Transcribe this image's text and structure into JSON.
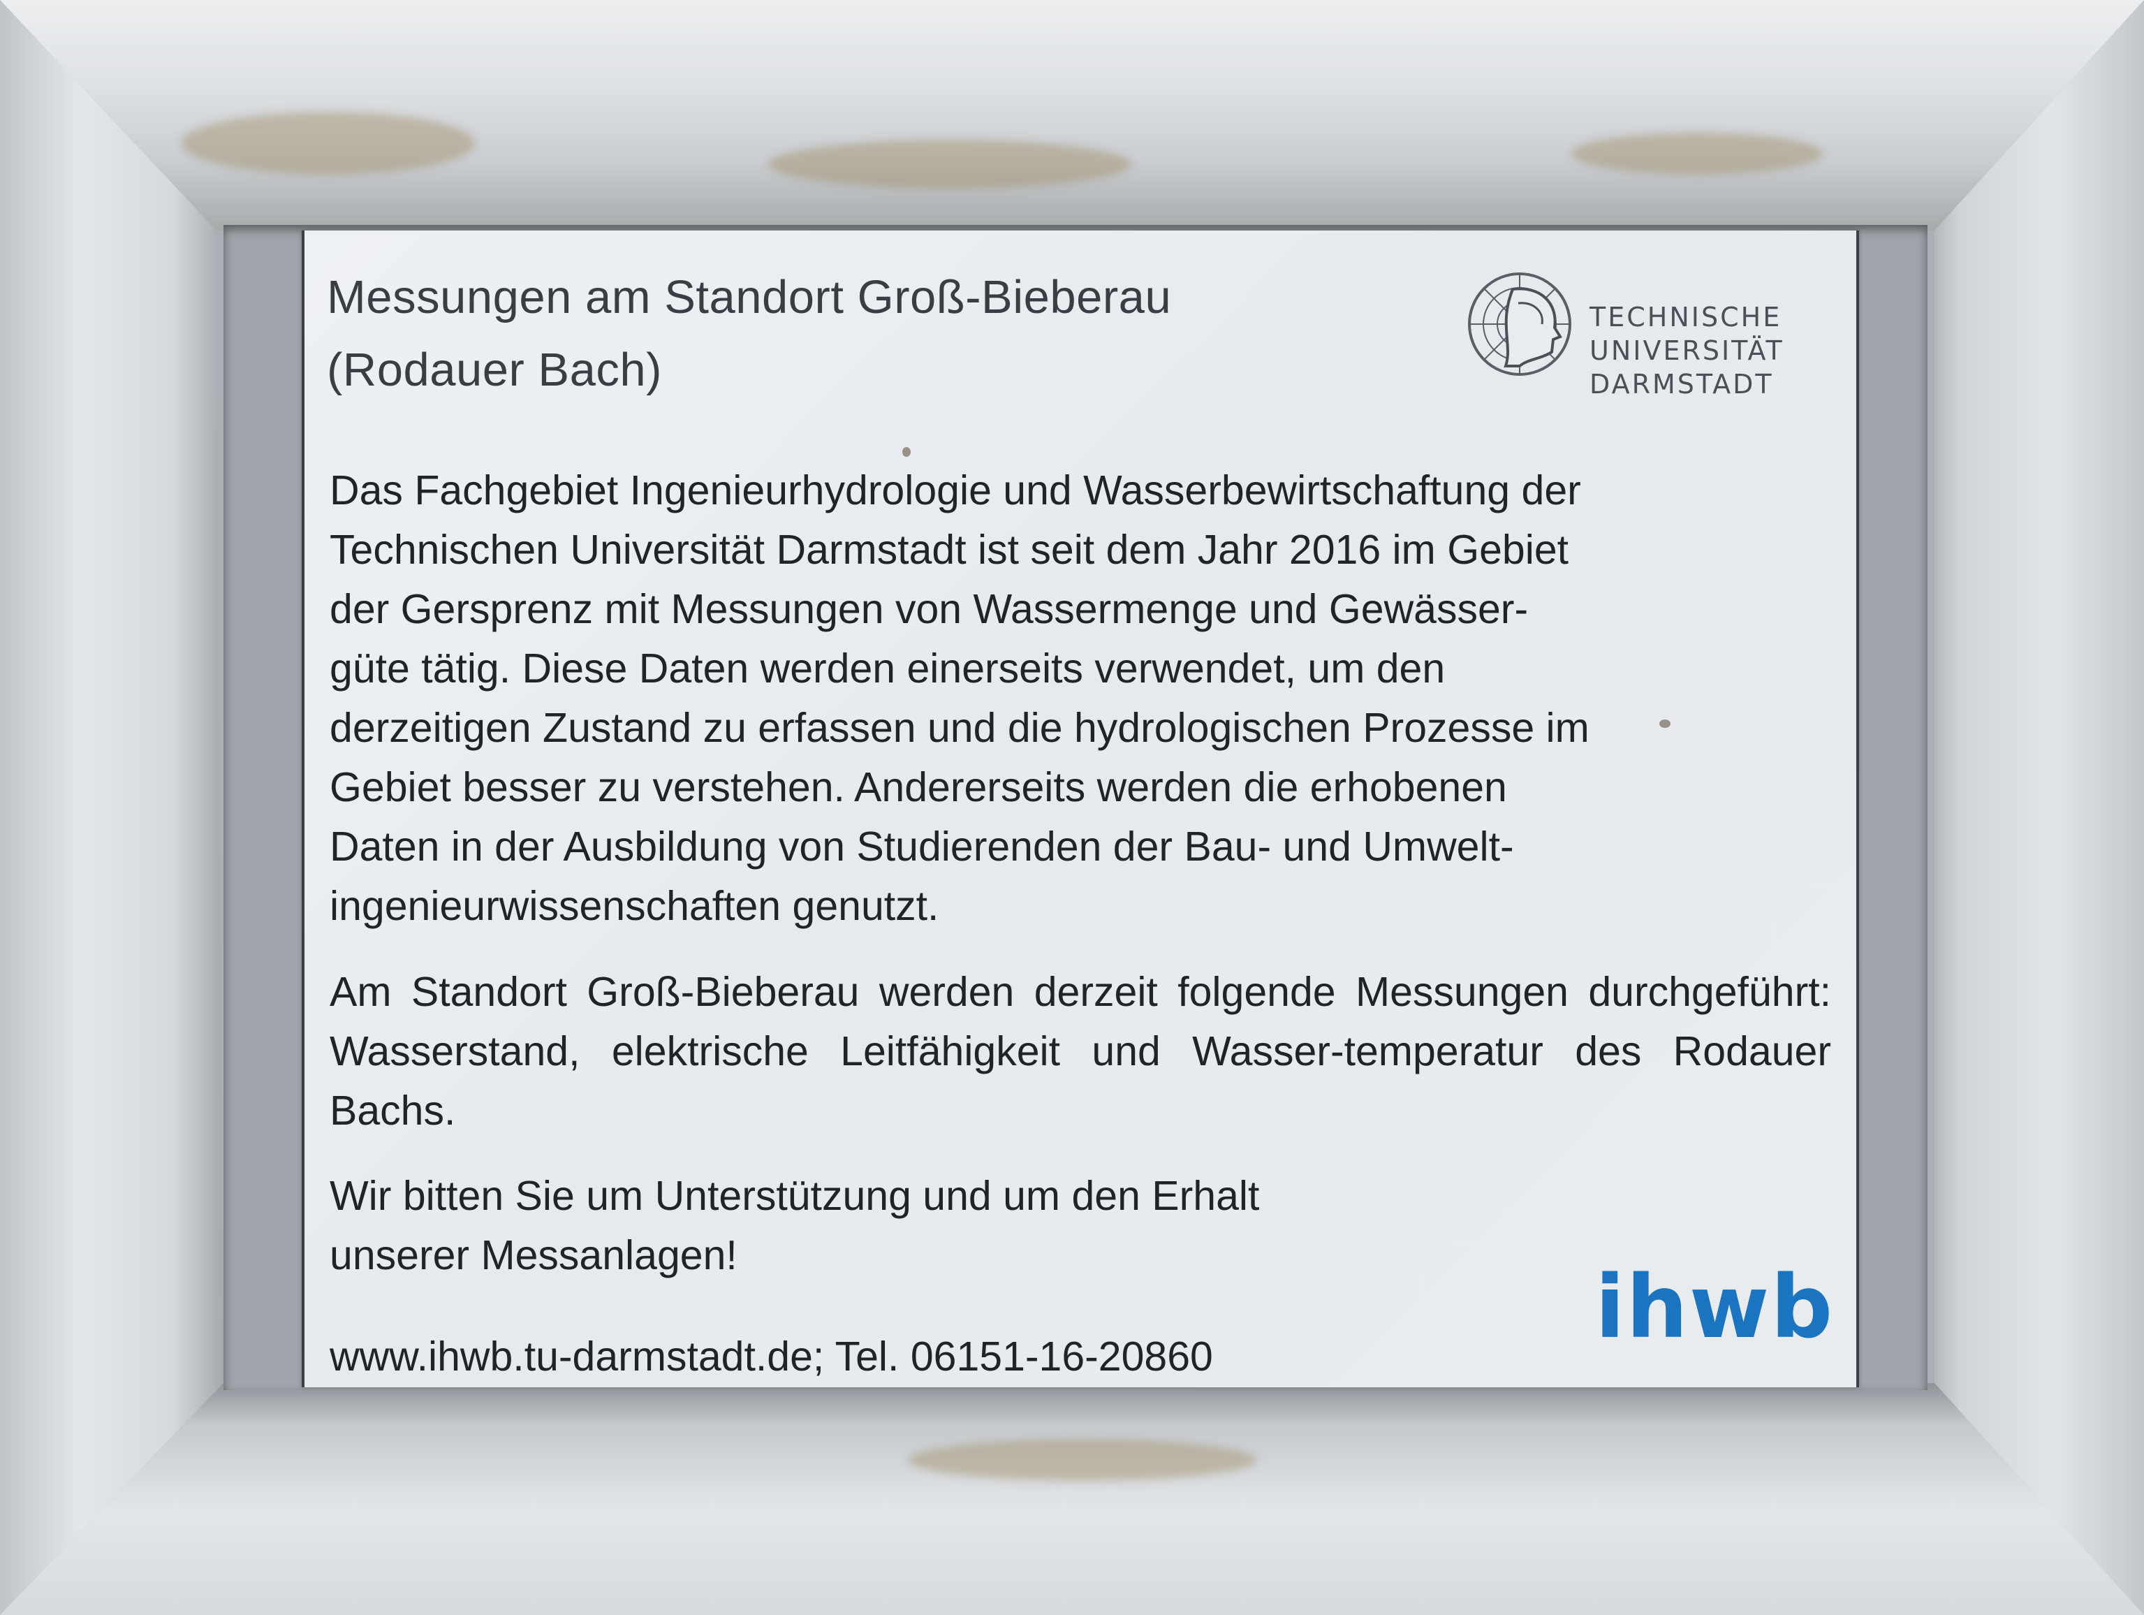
{
  "sign": {
    "title_line1": "Messungen am Standort Groß-Bieberau",
    "title_line2": "(Rodauer Bach)",
    "logo": {
      "icon": "athena-head-seal-icon",
      "line1": "TECHNISCHE",
      "line2": "UNIVERSITÄT",
      "line3": "DARMSTADT"
    },
    "paragraph1_lines": [
      "Das Fachgebiet Ingenieurhydrologie und Wasserbewirtschaftung der",
      "Technischen Universität Darmstadt ist seit dem Jahr 2016 im Gebiet",
      "der Gersprenz mit Messungen von Wassermenge und Gewässer-",
      "güte tätig. Diese Daten werden einerseits verwendet, um den",
      "derzeitigen Zustand zu erfassen und die hydrologischen Prozesse im",
      "Gebiet besser zu verstehen. Andererseits werden die erhobenen",
      "Daten in der Ausbildung von Studierenden der Bau- und Umwelt-",
      "ingenieurwissenschaften genutzt."
    ],
    "paragraph2": "Am Standort Groß-Bieberau werden derzeit folgende Messungen durchgeführt: Wasserstand, elektrische Leitfähigkeit und Wasser-temperatur des Rodauer Bachs.",
    "paragraph3_line1": "Wir bitten Sie um Unterstützung und um den Erhalt",
    "paragraph3_line2": "unserer Messanlagen!",
    "contact": "www.ihwb.tu-darmstadt.de; Tel. 06151-16-20860",
    "ihwb_logo_text": "ihwb",
    "colors": {
      "ihwb_blue": "#1b74c0",
      "text": "#202428",
      "frame": "#dfe2e5",
      "panel": "#e9ecef"
    }
  }
}
